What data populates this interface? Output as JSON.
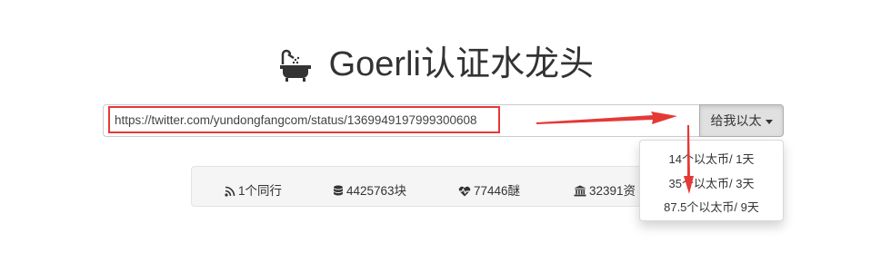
{
  "header": {
    "title": "Goerli认证水龙头",
    "icon": "bathtub-icon"
  },
  "request_form": {
    "url_value": "https://twitter.com/yundongfangcom/status/1369949197999300608",
    "dropdown_label": "给我以太"
  },
  "dropdown_menu": {
    "items": [
      {
        "label": "14个以太币/ 1天"
      },
      {
        "label": "35个以太币/ 3天"
      },
      {
        "label": "87.5个以太币/ 9天"
      }
    ]
  },
  "stats": [
    {
      "icon": "rss-icon",
      "label": "1个同行"
    },
    {
      "icon": "database-icon",
      "label": "4425763块"
    },
    {
      "icon": "heartbeat-icon",
      "label": "77446醚"
    },
    {
      "icon": "bank-icon",
      "label": "32391资"
    }
  ],
  "annotations": {
    "highlight_color": "#e53935",
    "arrow_color": "#e53935"
  }
}
